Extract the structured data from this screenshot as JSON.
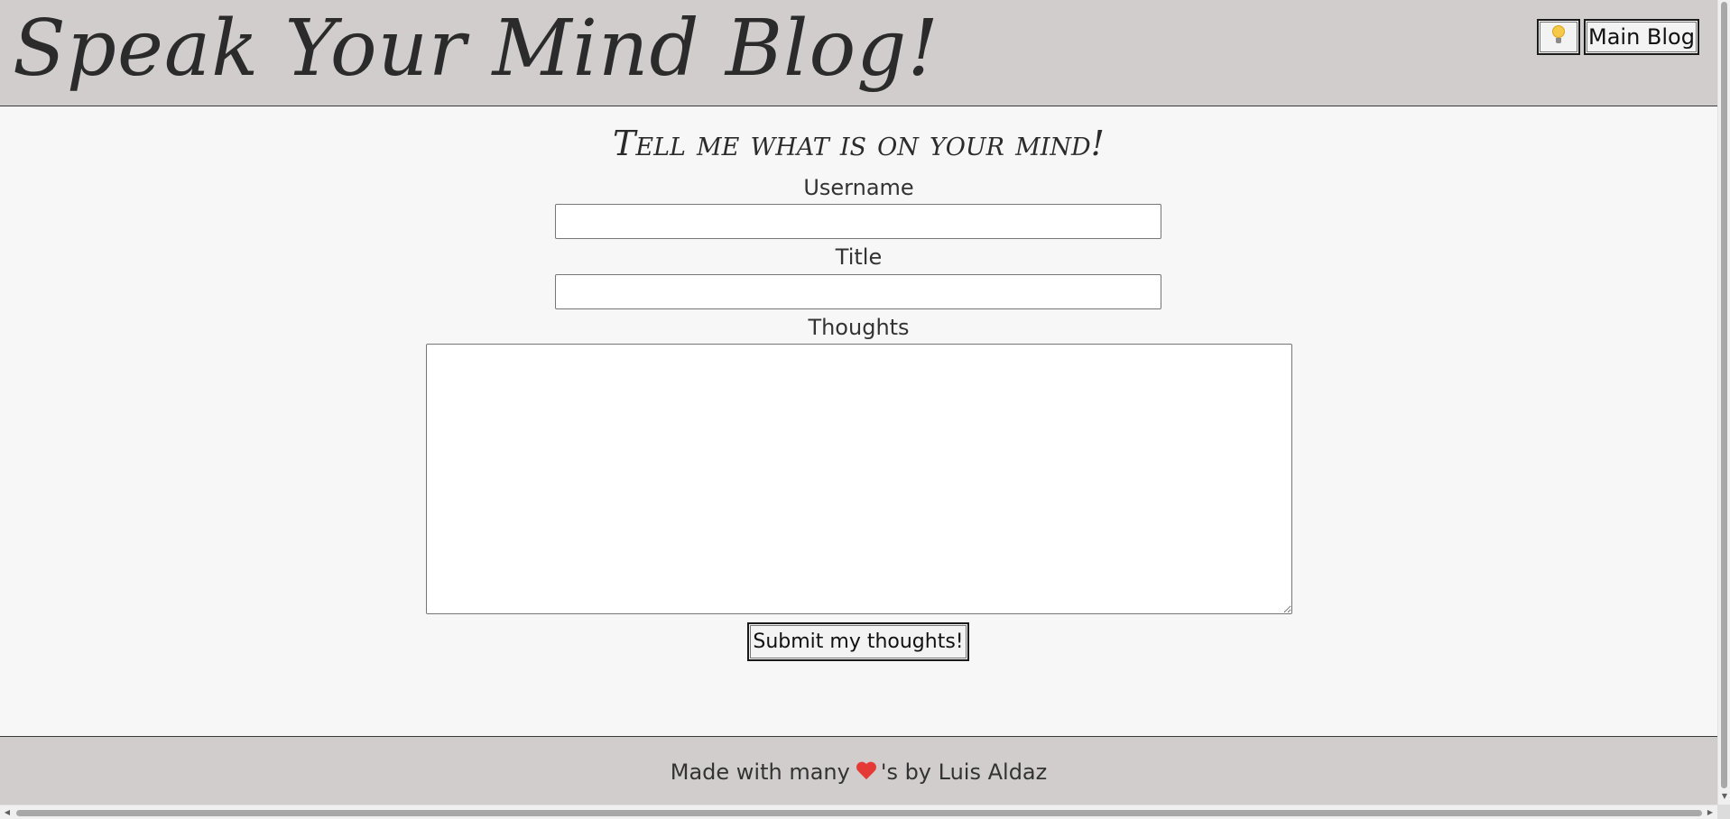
{
  "header": {
    "site_title": "Speak Your Mind Blog!",
    "theme_toggle_icon": "lightbulb-icon",
    "main_blog_label": "Main Blog"
  },
  "form": {
    "heading": "Tell me what is on your mind!",
    "username_label": "Username",
    "username_value": "",
    "title_label": "Title",
    "title_value": "",
    "thoughts_label": "Thoughts",
    "thoughts_value": "",
    "submit_label": "Submit my thoughts!"
  },
  "footer": {
    "text_before": "Made with many",
    "heart_icon": "heart-icon",
    "text_after": "'s by Luis Aldaz"
  },
  "colors": {
    "header_bg": "#d1cdcd",
    "page_bg": "#f7f7f7",
    "text": "#2b2b2b",
    "heart": "#e53935",
    "bulb": "#f7c948"
  }
}
